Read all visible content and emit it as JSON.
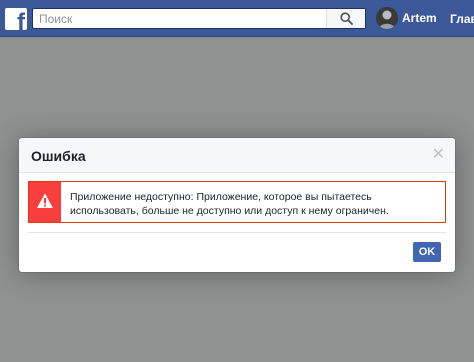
{
  "topbar": {
    "logo_icon": "facebook-f-icon",
    "logo_letter": "f",
    "background": "#3b5998",
    "search": {
      "placeholder": "Поиск",
      "value": "",
      "button_icon": "search-icon"
    },
    "profile": {
      "name": "Artem",
      "avatar_icon": "user-avatar"
    },
    "home_label": "Глав"
  },
  "dialog": {
    "title": "Ошибка",
    "close_icon": "close-icon",
    "error": {
      "icon": "warning-triangle-icon",
      "accent_color": "#fa3e3e",
      "message": "Приложение недоступно: Приложение, которое вы пытаетесь использовать, больше не доступно или доступ к нему ограничен."
    },
    "ok_label": "OK",
    "ok_color": "#4267b2"
  }
}
